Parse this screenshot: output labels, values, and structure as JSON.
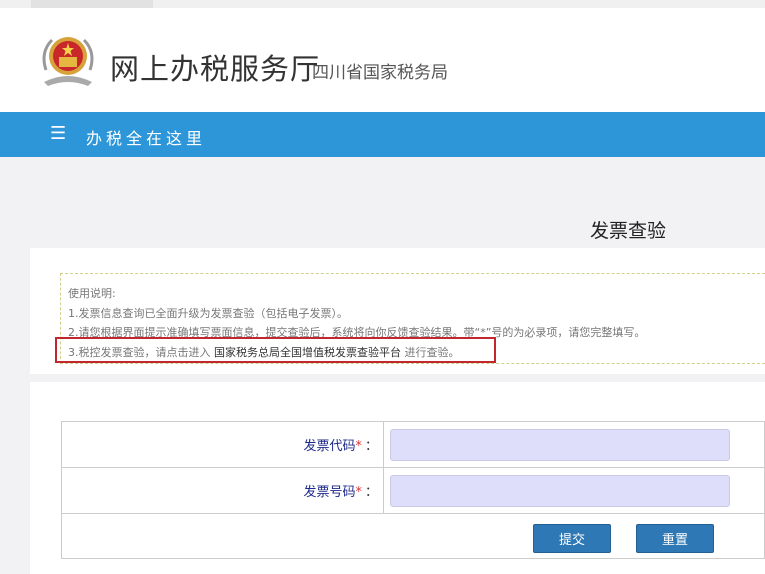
{
  "header": {
    "title": "网上办税服务厅",
    "subtitle": "四川省国家税务局"
  },
  "nav": {
    "menu_icon": "☰",
    "label": "办税全在这里"
  },
  "page": {
    "title": "发票查验"
  },
  "notes": {
    "heading": "使用说明:",
    "line1": "1.发票信息查询已全面升级为发票查验（包括电子发票）。",
    "line2": "2.请您根据界面提示准确填写票面信息，提交查验后，系统将向你反馈查验结果。带“*”号的为必录项，请您完整填写。",
    "line3_prefix": "3.税控发票查验，请点击进入",
    "line3_link": "国家税务总局全国增值税发票查验平台",
    "line3_suffix": "进行查验。"
  },
  "form": {
    "fields": [
      {
        "label": "发票代码",
        "required": "*",
        "colon": "：",
        "value": ""
      },
      {
        "label": "发票号码",
        "required": "*",
        "colon": "：",
        "value": ""
      }
    ],
    "submit": "提交",
    "reset": "重置"
  }
}
